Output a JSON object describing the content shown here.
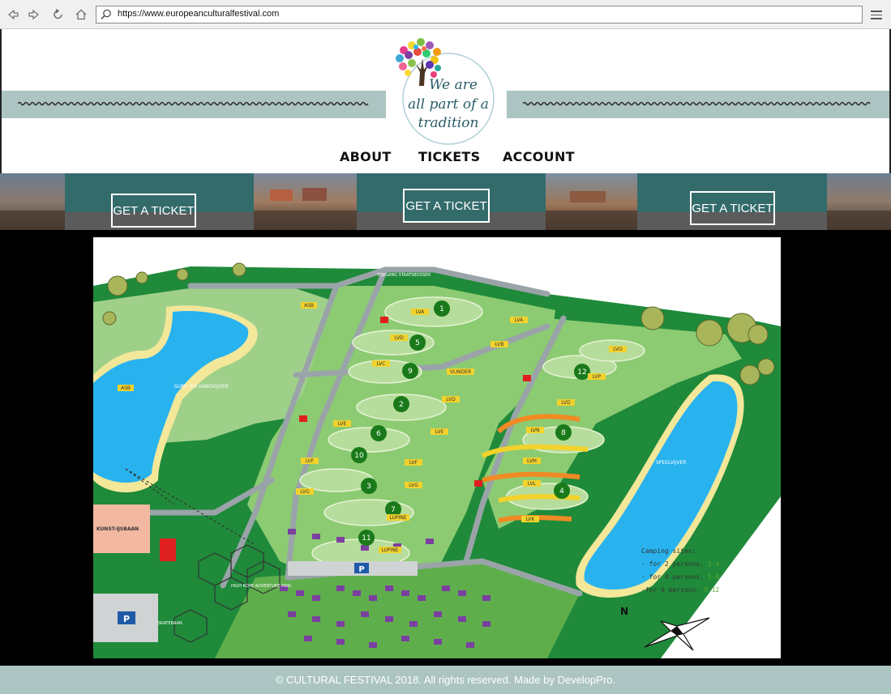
{
  "browser": {
    "url": "https://www.europeanculturalfestival.com"
  },
  "logo": {
    "line1": "We are",
    "line2": "all part of a",
    "line3": "tradition"
  },
  "nav": {
    "items": [
      {
        "label": "ABOUT"
      },
      {
        "label": "TICKETS"
      },
      {
        "label": "ACCOUNT"
      }
    ]
  },
  "tickets": {
    "buttons": [
      {
        "label": "GET A TICKET"
      },
      {
        "label": "GET A TICKET"
      },
      {
        "label": "GET A TICKET"
      }
    ]
  },
  "map": {
    "top_label": "TOEGANG STAATSBOSSEN",
    "lake_left": "SURF- EN KANOVIJVER",
    "lake_right": "SPEELVIJVER",
    "high_rope": "HIGH ROPE ADVENTURE PARC",
    "skate": "SKATEBAAN",
    "kunst": "KUNST-IJSBAAN",
    "compass_n": "N",
    "parking": "P",
    "site_numbers": [
      "1",
      "2",
      "3",
      "4",
      "5",
      "6",
      "7",
      "8",
      "9",
      "10",
      "11",
      "12"
    ],
    "field_labels": [
      "LVA",
      "LVA",
      "LVB",
      "LVD",
      "LVC",
      "VLINDER",
      "LVD",
      "LVD",
      "LVE",
      "LVE",
      "LVF",
      "LVF",
      "LVG",
      "LVG",
      "LUPINE",
      "LUPINE",
      "LVN",
      "LVM",
      "LVL",
      "LVK",
      "LVO",
      "LVP",
      "ASB",
      "ASB"
    ],
    "legend": {
      "title": "Camping sites:",
      "rows": [
        {
          "text": "- for 2 persons, ",
          "range": "1-4"
        },
        {
          "text": "- for 4 persons, ",
          "range": "5-8"
        },
        {
          "text": "-for 6 persons, ",
          "range": "9-12"
        }
      ]
    }
  },
  "footer": {
    "text": "© CULTURAL FESTIVAL 2018. All rights reserved. Made by DevelopPro."
  },
  "colors": {
    "teal": "#336b6b",
    "band": "#acc5c2",
    "grass": "#7fc36b",
    "forest": "#1f8a3a",
    "water": "#29b3ee",
    "beach": "#f3e79a",
    "legend_green": "#5aa832"
  },
  "icons": [
    "back-icon",
    "forward-icon",
    "refresh-icon",
    "home-icon",
    "search-icon",
    "menu-icon",
    "compass-icon",
    "parking-icon"
  ]
}
